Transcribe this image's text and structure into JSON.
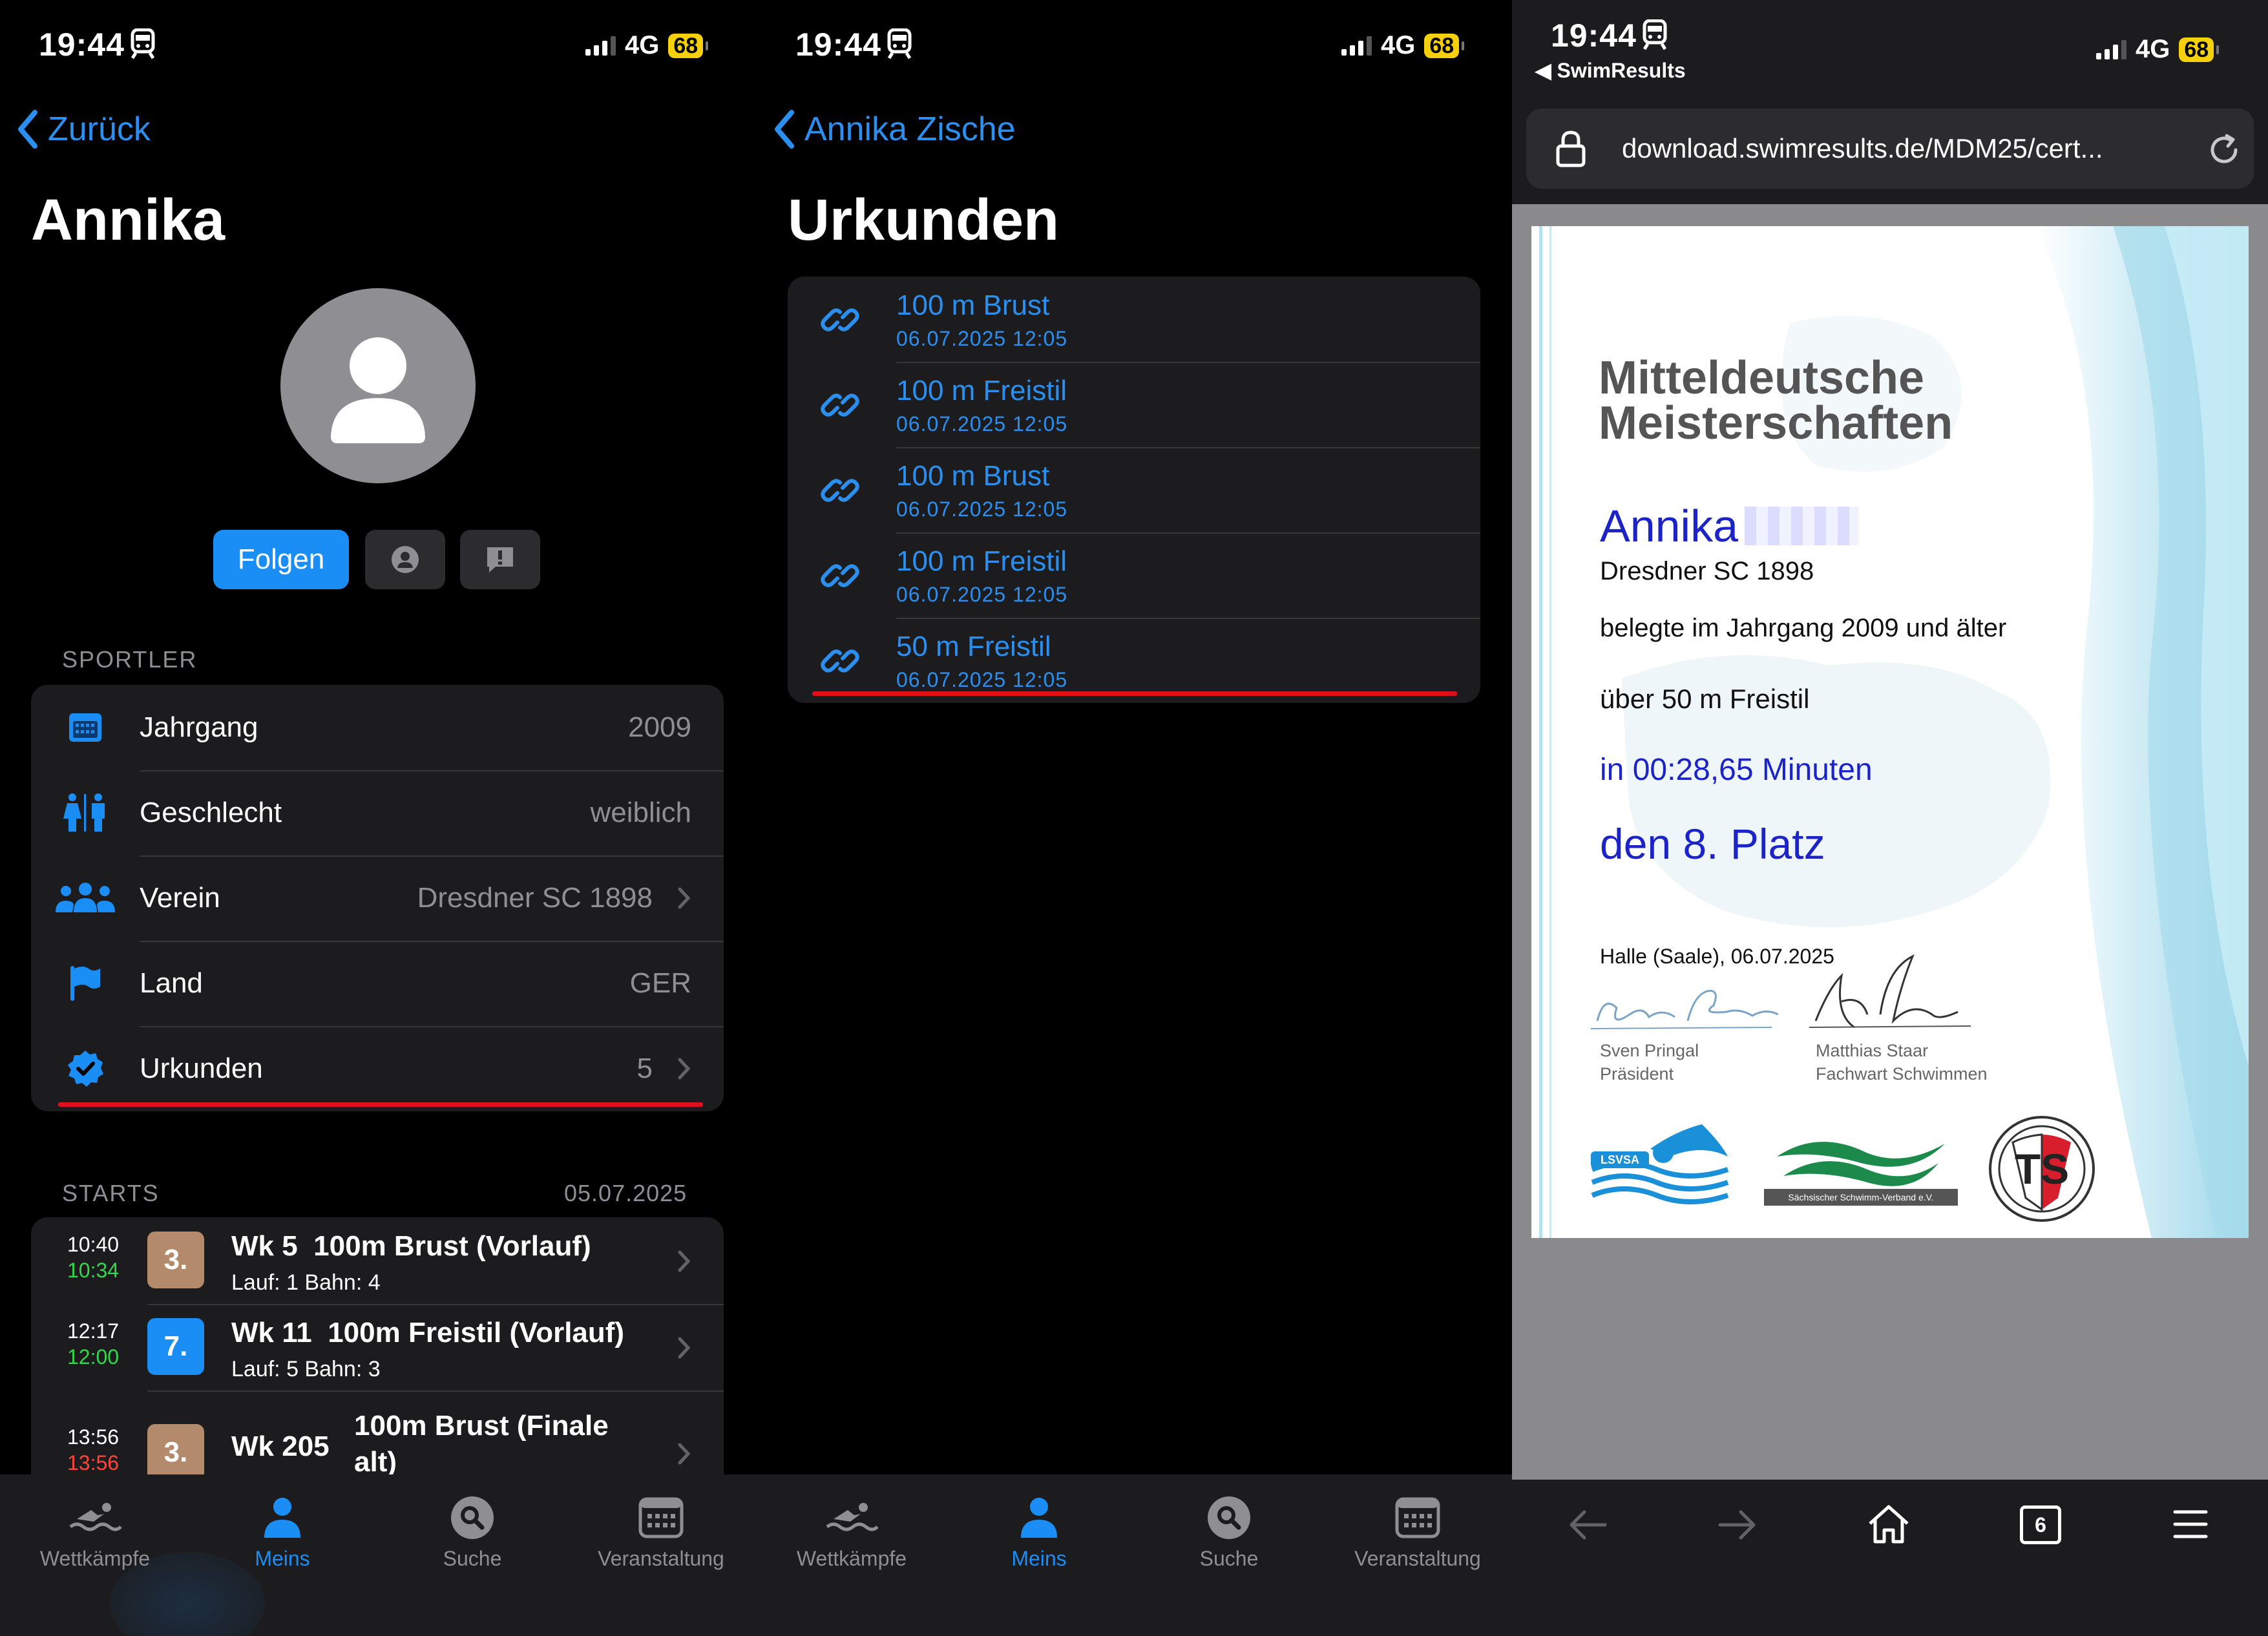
{
  "status": {
    "time": "19:44",
    "network": "4G",
    "battery": "68"
  },
  "panel1": {
    "back_label": "Zurück",
    "title": "Annika",
    "follow_label": "Folgen",
    "section_athlete": "SPORTLER",
    "rows": [
      {
        "label": "Jahrgang",
        "value": "2009"
      },
      {
        "label": "Geschlecht",
        "value": "weiblich"
      },
      {
        "label": "Verein",
        "value": "Dresdner SC 1898"
      },
      {
        "label": "Land",
        "value": "GER"
      },
      {
        "label": "Urkunden",
        "value": "5"
      }
    ],
    "section_starts": "STARTS",
    "starts_date": "05.07.2025",
    "starts": [
      {
        "time_planned": "10:40",
        "time_actual": "10:34",
        "place": "3.",
        "wk": "Wk 5",
        "event": "100m Brust (Vorlauf)",
        "detail": "Lauf: 1  Bahn: 4"
      },
      {
        "time_planned": "12:17",
        "time_actual": "12:00",
        "place": "7.",
        "wk": "Wk 11",
        "event": "100m Freistil (Vorlauf)",
        "detail": "Lauf: 5  Bahn: 3"
      },
      {
        "time_planned": "13:56",
        "time_actual": "13:56",
        "place": "3.",
        "wk": "Wk 205",
        "event": "100m Brust (Finale",
        "event2": "alt)"
      }
    ]
  },
  "panel2": {
    "back_label": "Annika Zische",
    "title": "Urkunden",
    "items": [
      {
        "title": "100 m Brust",
        "date": "06.07.2025 12:05"
      },
      {
        "title": "100 m Freistil",
        "date": "06.07.2025 12:05"
      },
      {
        "title": "100 m Brust",
        "date": "06.07.2025 12:05"
      },
      {
        "title": "100 m Freistil",
        "date": "06.07.2025 12:05"
      },
      {
        "title": "50 m Freistil",
        "date": "06.07.2025 12:05"
      }
    ]
  },
  "tabs": [
    "Wettkämpfe",
    "Meins",
    "Suche",
    "Veranstaltung"
  ],
  "panel3": {
    "back_app": "SwimResults",
    "url": "download.swimresults.de/MDM25/cert...",
    "tab_count": "6",
    "certificate": {
      "heading_line1": "Mitteldeutsche",
      "heading_line2": "Meisterschaften",
      "name": "Annika",
      "club": "Dresdner SC 1898",
      "line_year": "belegte im Jahrgang 2009 und älter",
      "line_event": "über 50 m Freistil",
      "line_time": "in 00:28,65 Minuten",
      "line_place": "den 8. Platz",
      "place_date": "Halle (Saale), 06.07.2025",
      "sig1_name": "Sven Pringal",
      "sig1_role": "Präsident",
      "sig2_name": "Matthias Staar",
      "sig2_role": "Fachwart Schwimmen",
      "logo1_text": "LSVSA",
      "logo2_text": "Sächsischer Schwimm-Verband e.V.",
      "logo3_text": "TS"
    }
  },
  "colors": {
    "accent": "#1a8ef5",
    "place_bronze": "#b48a6c",
    "place_blue": "#1a8ef5",
    "cert_blue": "#1c24c8",
    "underline_red": "#e0101a"
  }
}
